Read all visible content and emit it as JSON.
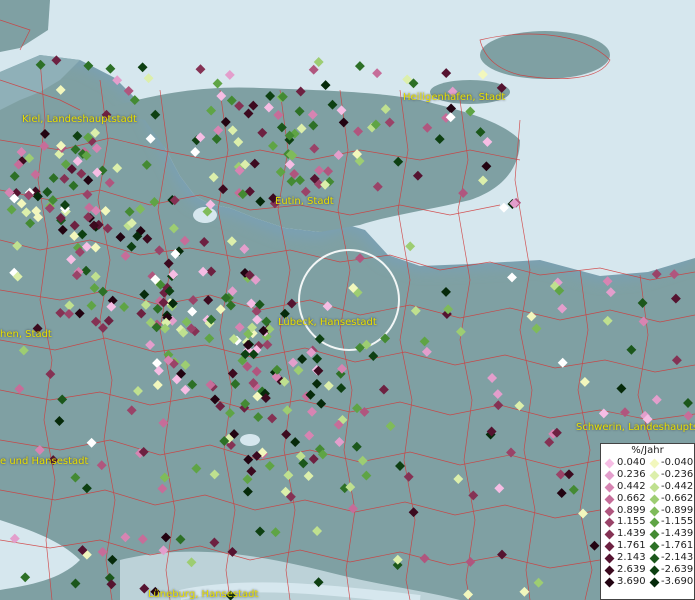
{
  "map": {
    "cities": [
      {
        "name": "Kiel, Landeshauptstadt"
      },
      {
        "name": "Heiligenhafen, Stadt"
      },
      {
        "name": "Eutin, Stadt"
      },
      {
        "name": "Lübeck, Hansestadt"
      },
      {
        "name": "hen, Stadt"
      },
      {
        "name": "e und Hansestadt"
      },
      {
        "name": "Schwerin, Landeshauptst"
      },
      {
        "name": "Lüneburg, Hansestadt"
      }
    ]
  },
  "legend": {
    "title": "%/Jahr",
    "positive": [
      "0.040",
      "0.236",
      "0.442",
      "0.662",
      "0.899",
      "1.155",
      "1.439",
      "1.761",
      "2.143",
      "2.639",
      "3.690"
    ],
    "negative": [
      "-0.040",
      "-0.236",
      "-0.442",
      "-0.662",
      "-0.899",
      "-1.155",
      "-1.439",
      "-1.761",
      "-2.143",
      "-2.639",
      "-3.690"
    ],
    "positive_colors": [
      "#f6bde4",
      "#e39ecc",
      "#d784b2",
      "#c66d99",
      "#b0567e",
      "#9a4368",
      "#853254",
      "#6d2141",
      "#551330",
      "#3c0a1f",
      "#220311"
    ],
    "negative_colors": [
      "#f2f7bd",
      "#dcefab",
      "#bfe08f",
      "#9dcd72",
      "#7fbb5a",
      "#5fa445",
      "#448a33",
      "#2d7026",
      "#1b571b",
      "#0e4012",
      "#062a0a"
    ]
  }
}
